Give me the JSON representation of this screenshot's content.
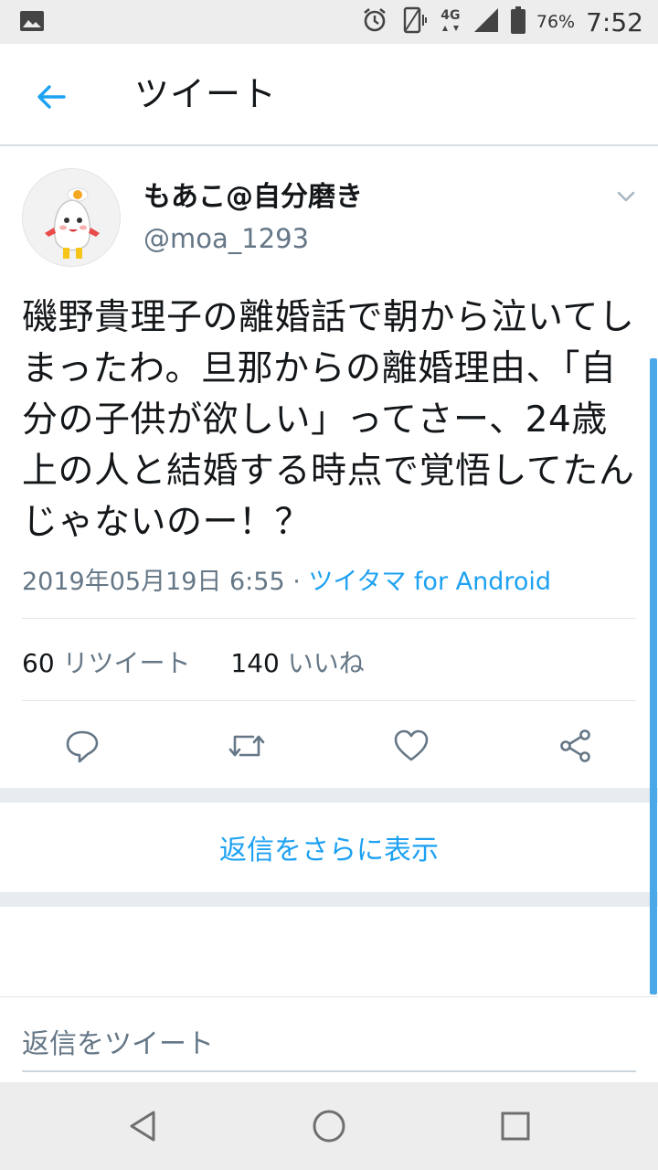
{
  "status_bar": {
    "battery_percent": "76%",
    "time": "7:52",
    "network": "4G",
    "icons": [
      "gallery-icon",
      "alarm-icon",
      "vibrate-icon",
      "network-4g-icon",
      "signal-icon",
      "battery-icon"
    ]
  },
  "app_bar": {
    "title": "ツイート",
    "back_icon": "arrow-left-icon"
  },
  "tweet": {
    "display_name": "もあこ@自分磨き",
    "handle": "@moa_1293",
    "text": "磯野貴理子の離婚話で朝から泣いてしまったわ。旦那からの離婚理由、「自分の子供が欲しい」ってさー、24歳上の人と結婚する時点で覚悟してたんじゃないのー！？",
    "timestamp": "2019年05月19日 6:55",
    "separator": "·",
    "via": "ツイタマ for Android",
    "retweet_count": "60",
    "retweet_label": "リツイート",
    "like_count": "140",
    "like_label": "いいね",
    "actions": [
      "reply-icon",
      "retweet-icon",
      "like-icon",
      "share-icon"
    ]
  },
  "more_replies_label": "返信をさらに表示",
  "reply_bar": {
    "placeholder": "返信をツイート"
  },
  "nav_bar": {
    "buttons": [
      "back-triangle-icon",
      "home-circle-icon",
      "recents-square-icon"
    ]
  },
  "colors": {
    "accent": "#1da1f2",
    "secondary_text": "#657786",
    "primary_text": "#14171a",
    "divider": "#e1e8ed",
    "band": "#e6ecf0"
  }
}
